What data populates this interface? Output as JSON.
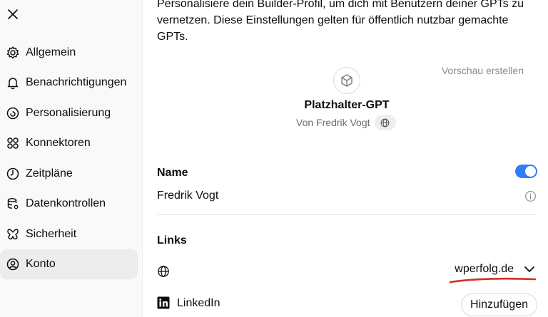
{
  "sidebar": {
    "close_icon": "close-icon",
    "items": [
      {
        "label": "Allgemein",
        "icon": "gear-icon",
        "active": false
      },
      {
        "label": "Benachrichtigungen",
        "icon": "bell-icon",
        "active": false
      },
      {
        "label": "Personalisierung",
        "icon": "personalization-icon",
        "active": false
      },
      {
        "label": "Konnektoren",
        "icon": "connectors-icon",
        "active": false
      },
      {
        "label": "Zeitpläne",
        "icon": "clock-icon",
        "active": false
      },
      {
        "label": "Datenkontrollen",
        "icon": "database-icon",
        "active": false
      },
      {
        "label": "Sicherheit",
        "icon": "shield-icon",
        "active": false
      },
      {
        "label": "Konto",
        "icon": "account-icon",
        "active": true
      }
    ]
  },
  "main": {
    "intro": "Personalisiere dein Builder-Profil, um dich mit Benutzern deiner GPTs zu vernetzen. Diese Einstellungen gelten für öffentlich nutzbar gemachte GPTs.",
    "preview_link": "Vorschau erstellen",
    "gpt": {
      "name": "Platzhalter-GPT",
      "author": "Von Fredrik Vogt",
      "avatar_icon": "cube-icon",
      "visibility_icon": "globe-icon"
    },
    "name_section": {
      "title": "Name",
      "value": "Fredrik Vogt",
      "toggle_on": true,
      "info_icon": "info-icon"
    },
    "links_section": {
      "title": "Links",
      "website": {
        "icon": "globe-icon",
        "selected_domain": "wperfolg.de"
      },
      "linkedin": {
        "icon": "linkedin-icon",
        "label": "LinkedIn",
        "button": "Hinzufügen"
      }
    }
  },
  "colors": {
    "accent": "#2f7ef7",
    "annotation": "#d92b2b",
    "sidebar_bg": "#f9f9f9",
    "active_bg": "#ececec",
    "muted_text": "#8a8a8a"
  }
}
